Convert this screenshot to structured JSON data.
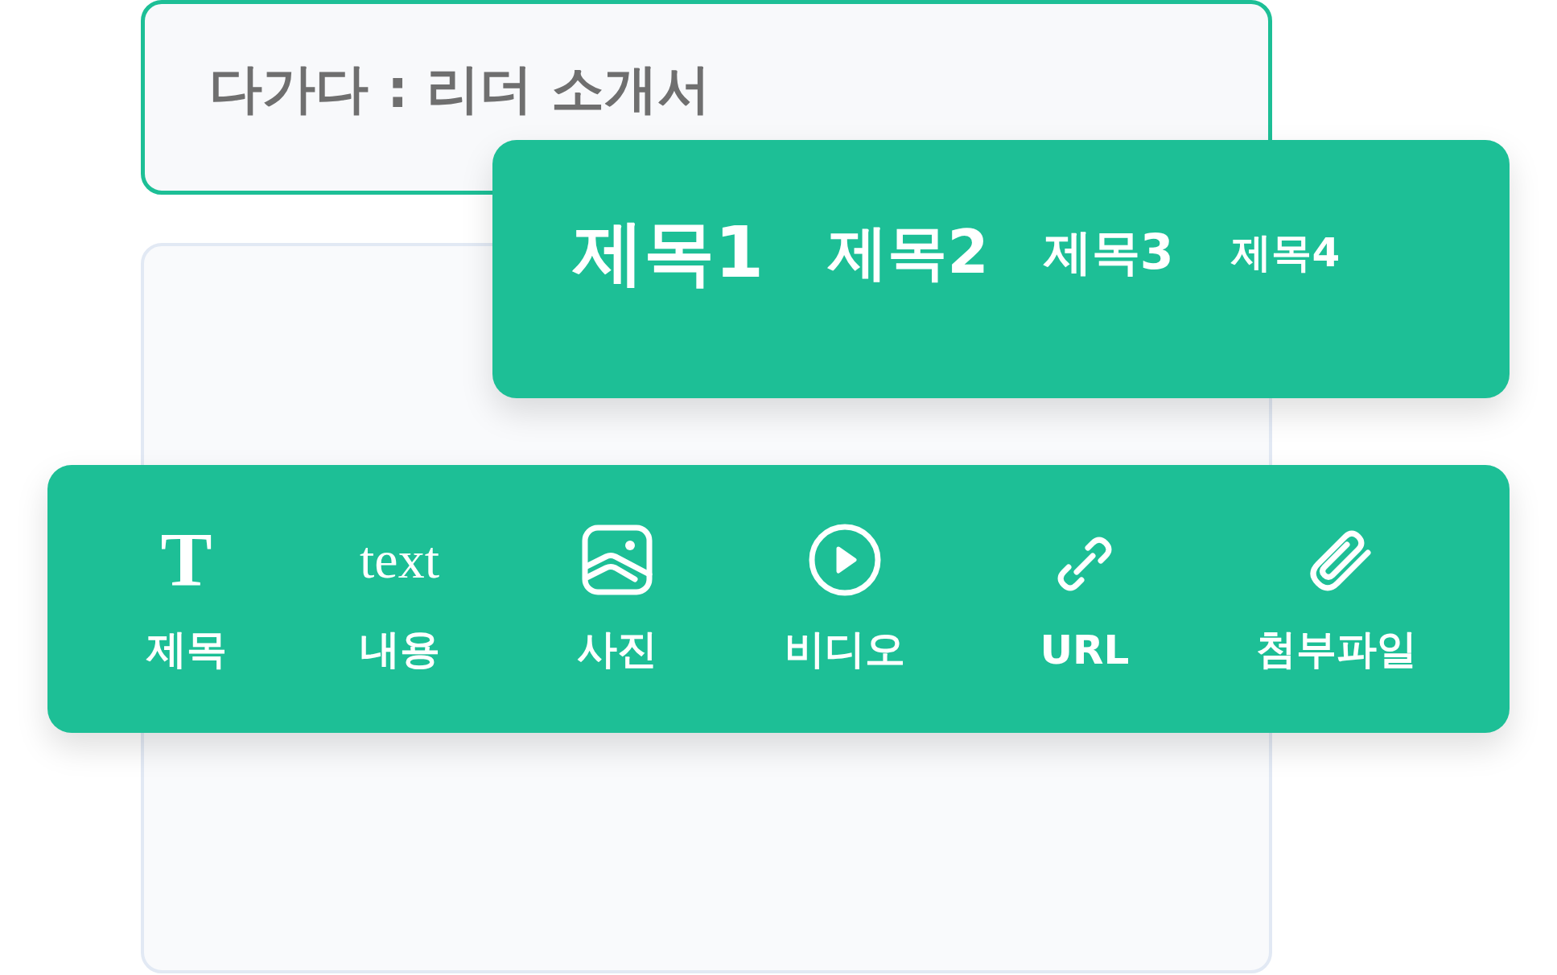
{
  "document": {
    "title": "다가다 : 리더 소개서"
  },
  "heading_menu": {
    "items": [
      {
        "label": "제목1"
      },
      {
        "label": "제목2"
      },
      {
        "label": "제목3"
      },
      {
        "label": "제목4"
      }
    ]
  },
  "insert_toolbar": {
    "items": [
      {
        "kind": "glyph",
        "glyph": "T",
        "label": "제목"
      },
      {
        "kind": "glyph",
        "glyph": "text",
        "label": "내용"
      },
      {
        "kind": "image",
        "label": "사진"
      },
      {
        "kind": "video",
        "label": "비디오"
      },
      {
        "kind": "link",
        "label": "URL"
      },
      {
        "kind": "attachment",
        "label": "첨부파일"
      }
    ]
  }
}
